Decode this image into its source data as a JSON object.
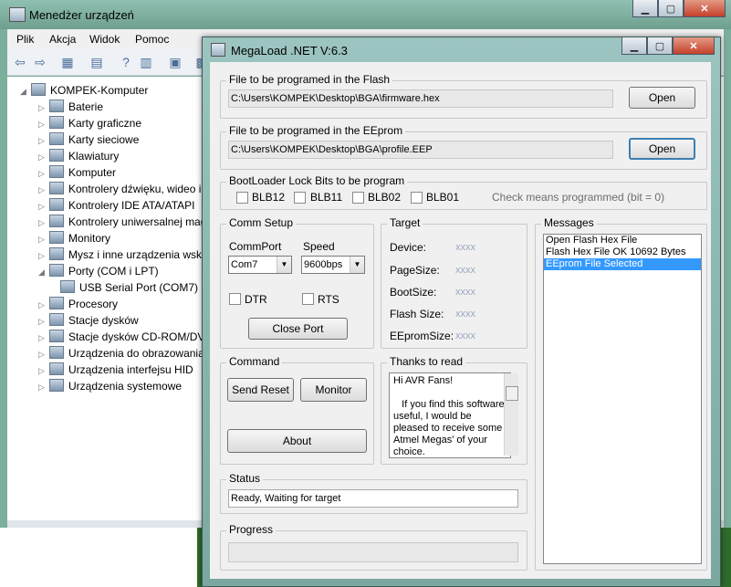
{
  "devmgr": {
    "title": "Menedżer urządzeń",
    "menu": [
      "Plik",
      "Akcja",
      "Widok",
      "Pomoc"
    ],
    "tree": [
      {
        "label": "KOMPEK-Komputer",
        "level": 0,
        "expander": "◢",
        "icon": "computer-icon"
      },
      {
        "label": "Baterie",
        "level": 1,
        "expander": "▷",
        "icon": "battery-icon"
      },
      {
        "label": "Karty graficzne",
        "level": 1,
        "expander": "▷",
        "icon": "display-adapter-icon"
      },
      {
        "label": "Karty sieciowe",
        "level": 1,
        "expander": "▷",
        "icon": "network-icon"
      },
      {
        "label": "Klawiatury",
        "level": 1,
        "expander": "▷",
        "icon": "keyboard-icon"
      },
      {
        "label": "Komputer",
        "level": 1,
        "expander": "▷",
        "icon": "monitor-icon"
      },
      {
        "label": "Kontrolery dźwięku, wideo i",
        "level": 1,
        "expander": "▷",
        "icon": "sound-icon"
      },
      {
        "label": "Kontrolery IDE ATA/ATAPI",
        "level": 1,
        "expander": "▷",
        "icon": "ide-icon"
      },
      {
        "label": "Kontrolery uniwersalnej mag",
        "level": 1,
        "expander": "▷",
        "icon": "usb-icon"
      },
      {
        "label": "Monitory",
        "level": 1,
        "expander": "▷",
        "icon": "monitor-icon"
      },
      {
        "label": "Mysz i inne urządzenia wska",
        "level": 1,
        "expander": "▷",
        "icon": "mouse-icon"
      },
      {
        "label": "Porty (COM i LPT)",
        "level": 1,
        "expander": "◢",
        "icon": "port-icon"
      },
      {
        "label": "USB Serial Port (COM7)",
        "level": 2,
        "expander": "",
        "icon": "port-icon"
      },
      {
        "label": "Procesory",
        "level": 1,
        "expander": "▷",
        "icon": "cpu-icon"
      },
      {
        "label": "Stacje dysków",
        "level": 1,
        "expander": "▷",
        "icon": "disk-icon"
      },
      {
        "label": "Stacje dysków CD-ROM/DVD",
        "level": 1,
        "expander": "▷",
        "icon": "cdrom-icon"
      },
      {
        "label": "Urządzenia do obrazowania",
        "level": 1,
        "expander": "▷",
        "icon": "camera-icon"
      },
      {
        "label": "Urządzenia interfejsu HID",
        "level": 1,
        "expander": "▷",
        "icon": "hid-icon"
      },
      {
        "label": "Urządzenia systemowe",
        "level": 1,
        "expander": "▷",
        "icon": "system-icon"
      }
    ]
  },
  "mega": {
    "title": "MegaLoad .NET V:6.3",
    "flash": {
      "legend": "File to be programed in the Flash",
      "path": "C:\\Users\\KOMPEK\\Desktop\\BGA\\firmware.hex",
      "open": "Open"
    },
    "eeprom": {
      "legend": "File to be programed in the EEprom",
      "path": "C:\\Users\\KOMPEK\\Desktop\\BGA\\profile.EEP",
      "open": "Open"
    },
    "lockbits": {
      "legend": "BootLoader Lock Bits to be program",
      "bits": [
        "BLB12",
        "BLB11",
        "BLB02",
        "BLB01"
      ],
      "note": "Check means programmed (bit = 0)"
    },
    "comm": {
      "legend": "Comm Setup",
      "port_label": "CommPort",
      "speed_label": "Speed",
      "port": "Com7",
      "speed": "9600bps",
      "dtr": "DTR",
      "rts": "RTS",
      "close": "Close Port"
    },
    "target": {
      "legend": "Target",
      "rows": [
        {
          "label": "Device:",
          "value": "xxxx"
        },
        {
          "label": "PageSize:",
          "value": "xxxx"
        },
        {
          "label": "BootSize:",
          "value": "xxxx"
        },
        {
          "label": "Flash Size:",
          "value": "xxxx"
        },
        {
          "label": "EEpromSize:",
          "value": "xxxx"
        }
      ]
    },
    "messages": {
      "legend": "Messages",
      "items": [
        "Open Flash Hex File",
        "Flash Hex File OK 10692 Bytes",
        "EEprom File Selected"
      ],
      "selected_index": 2
    },
    "command": {
      "legend": "Command",
      "send_reset": "Send Reset",
      "monitor": "Monitor",
      "about": "About"
    },
    "thanks": {
      "legend": "Thanks to read",
      "text": "Hi AVR Fans!\n\n   If you find this software useful, I would be pleased to receive some Atmel Megas' of your choice."
    },
    "status": {
      "legend": "Status",
      "text": "Ready, Waiting for target"
    },
    "progress": {
      "legend": "Progress",
      "value": 0
    }
  }
}
